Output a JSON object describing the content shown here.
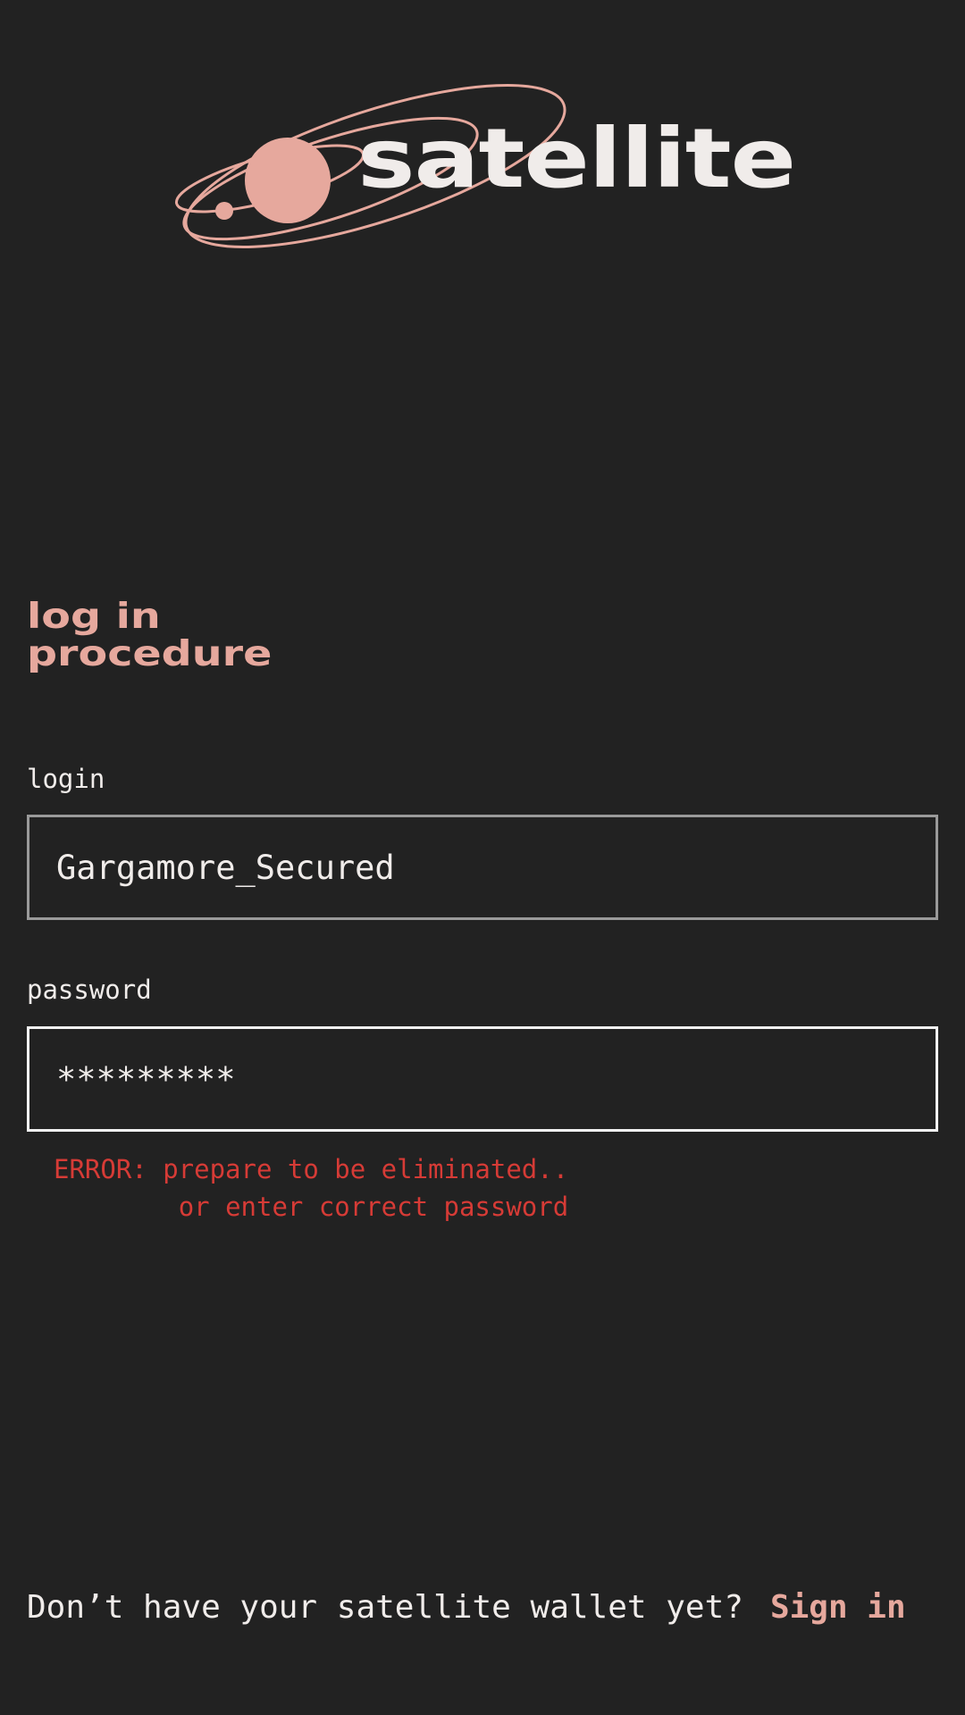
{
  "brand": {
    "name": "satellite",
    "accent_color": "#e6a89d",
    "background_color": "#222222",
    "text_color": "#f0ecea",
    "error_color": "#d63b36"
  },
  "page": {
    "heading_line1": "log in",
    "heading_line2": "procedure"
  },
  "form": {
    "login_label": "login",
    "login_value": "Gargamore_Secured",
    "password_label": "password",
    "password_value": "*********",
    "error_line1": "ERROR: prepare to be eliminated..",
    "error_line2": "or enter correct password"
  },
  "footer": {
    "prompt": "Don’t have your satellite wallet yet?",
    "signin_link": "Sign in"
  }
}
